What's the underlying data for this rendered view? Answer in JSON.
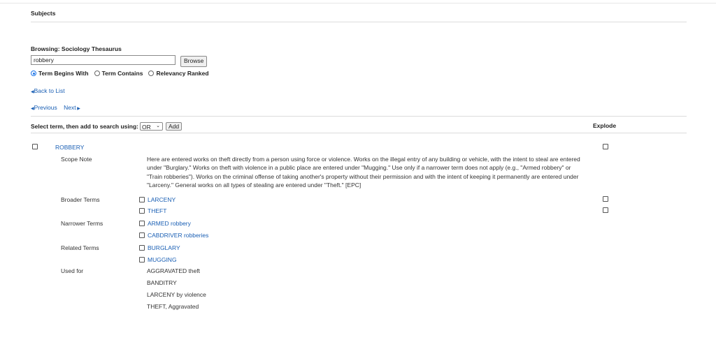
{
  "subjects_title": "Subjects",
  "browsing_label": "Browsing: Sociology Thesaurus",
  "search": {
    "value": "robbery",
    "button": "Browse"
  },
  "radios": [
    {
      "label": "Term Begins With",
      "selected": true
    },
    {
      "label": "Term Contains",
      "selected": false
    },
    {
      "label": "Relevancy Ranked",
      "selected": false
    }
  ],
  "nav": {
    "back": "Back to List",
    "previous": "Previous",
    "next": "Next"
  },
  "selectbar": {
    "label": "Select term, then add to search using:",
    "operator": "OR",
    "add": "Add",
    "explode_header": "Explode"
  },
  "term": "ROBBERY",
  "labels": {
    "scope": "Scope Note",
    "broader": "Broader Terms",
    "narrower": "Narrower Terms",
    "related": "Related Terms",
    "used_for": "Used for"
  },
  "scope_note": "Here are entered works on theft directly from a person using force or violence. Works on the illegal entry of any building or vehicle, with the intent to steal are entered under \"Burglary.\" Works on theft with violence in a public place are entered under \"Mugging.\" Use only if a narrower term does not apply (e.g., \"Armed robbery\" or \"Train robberies\"). Works on the criminal offense of taking another's property without their permission and with the intent of keeping it permanently are entered under \"Larceny.\" General works on all types of stealing are entered under \"Theft.\" [EPC]",
  "broader_terms": [
    "LARCENY",
    "THEFT"
  ],
  "narrower_terms": [
    "ARMED robbery",
    "CABDRIVER robberies"
  ],
  "related_terms": [
    "BURGLARY",
    "MUGGING"
  ],
  "used_for": [
    "AGGRAVATED theft",
    "BANDITRY",
    "LARCENY by violence",
    "THEFT, Aggravated"
  ],
  "colors": {
    "link": "#1a5fb4",
    "radio_accent": "#1a73e8"
  }
}
